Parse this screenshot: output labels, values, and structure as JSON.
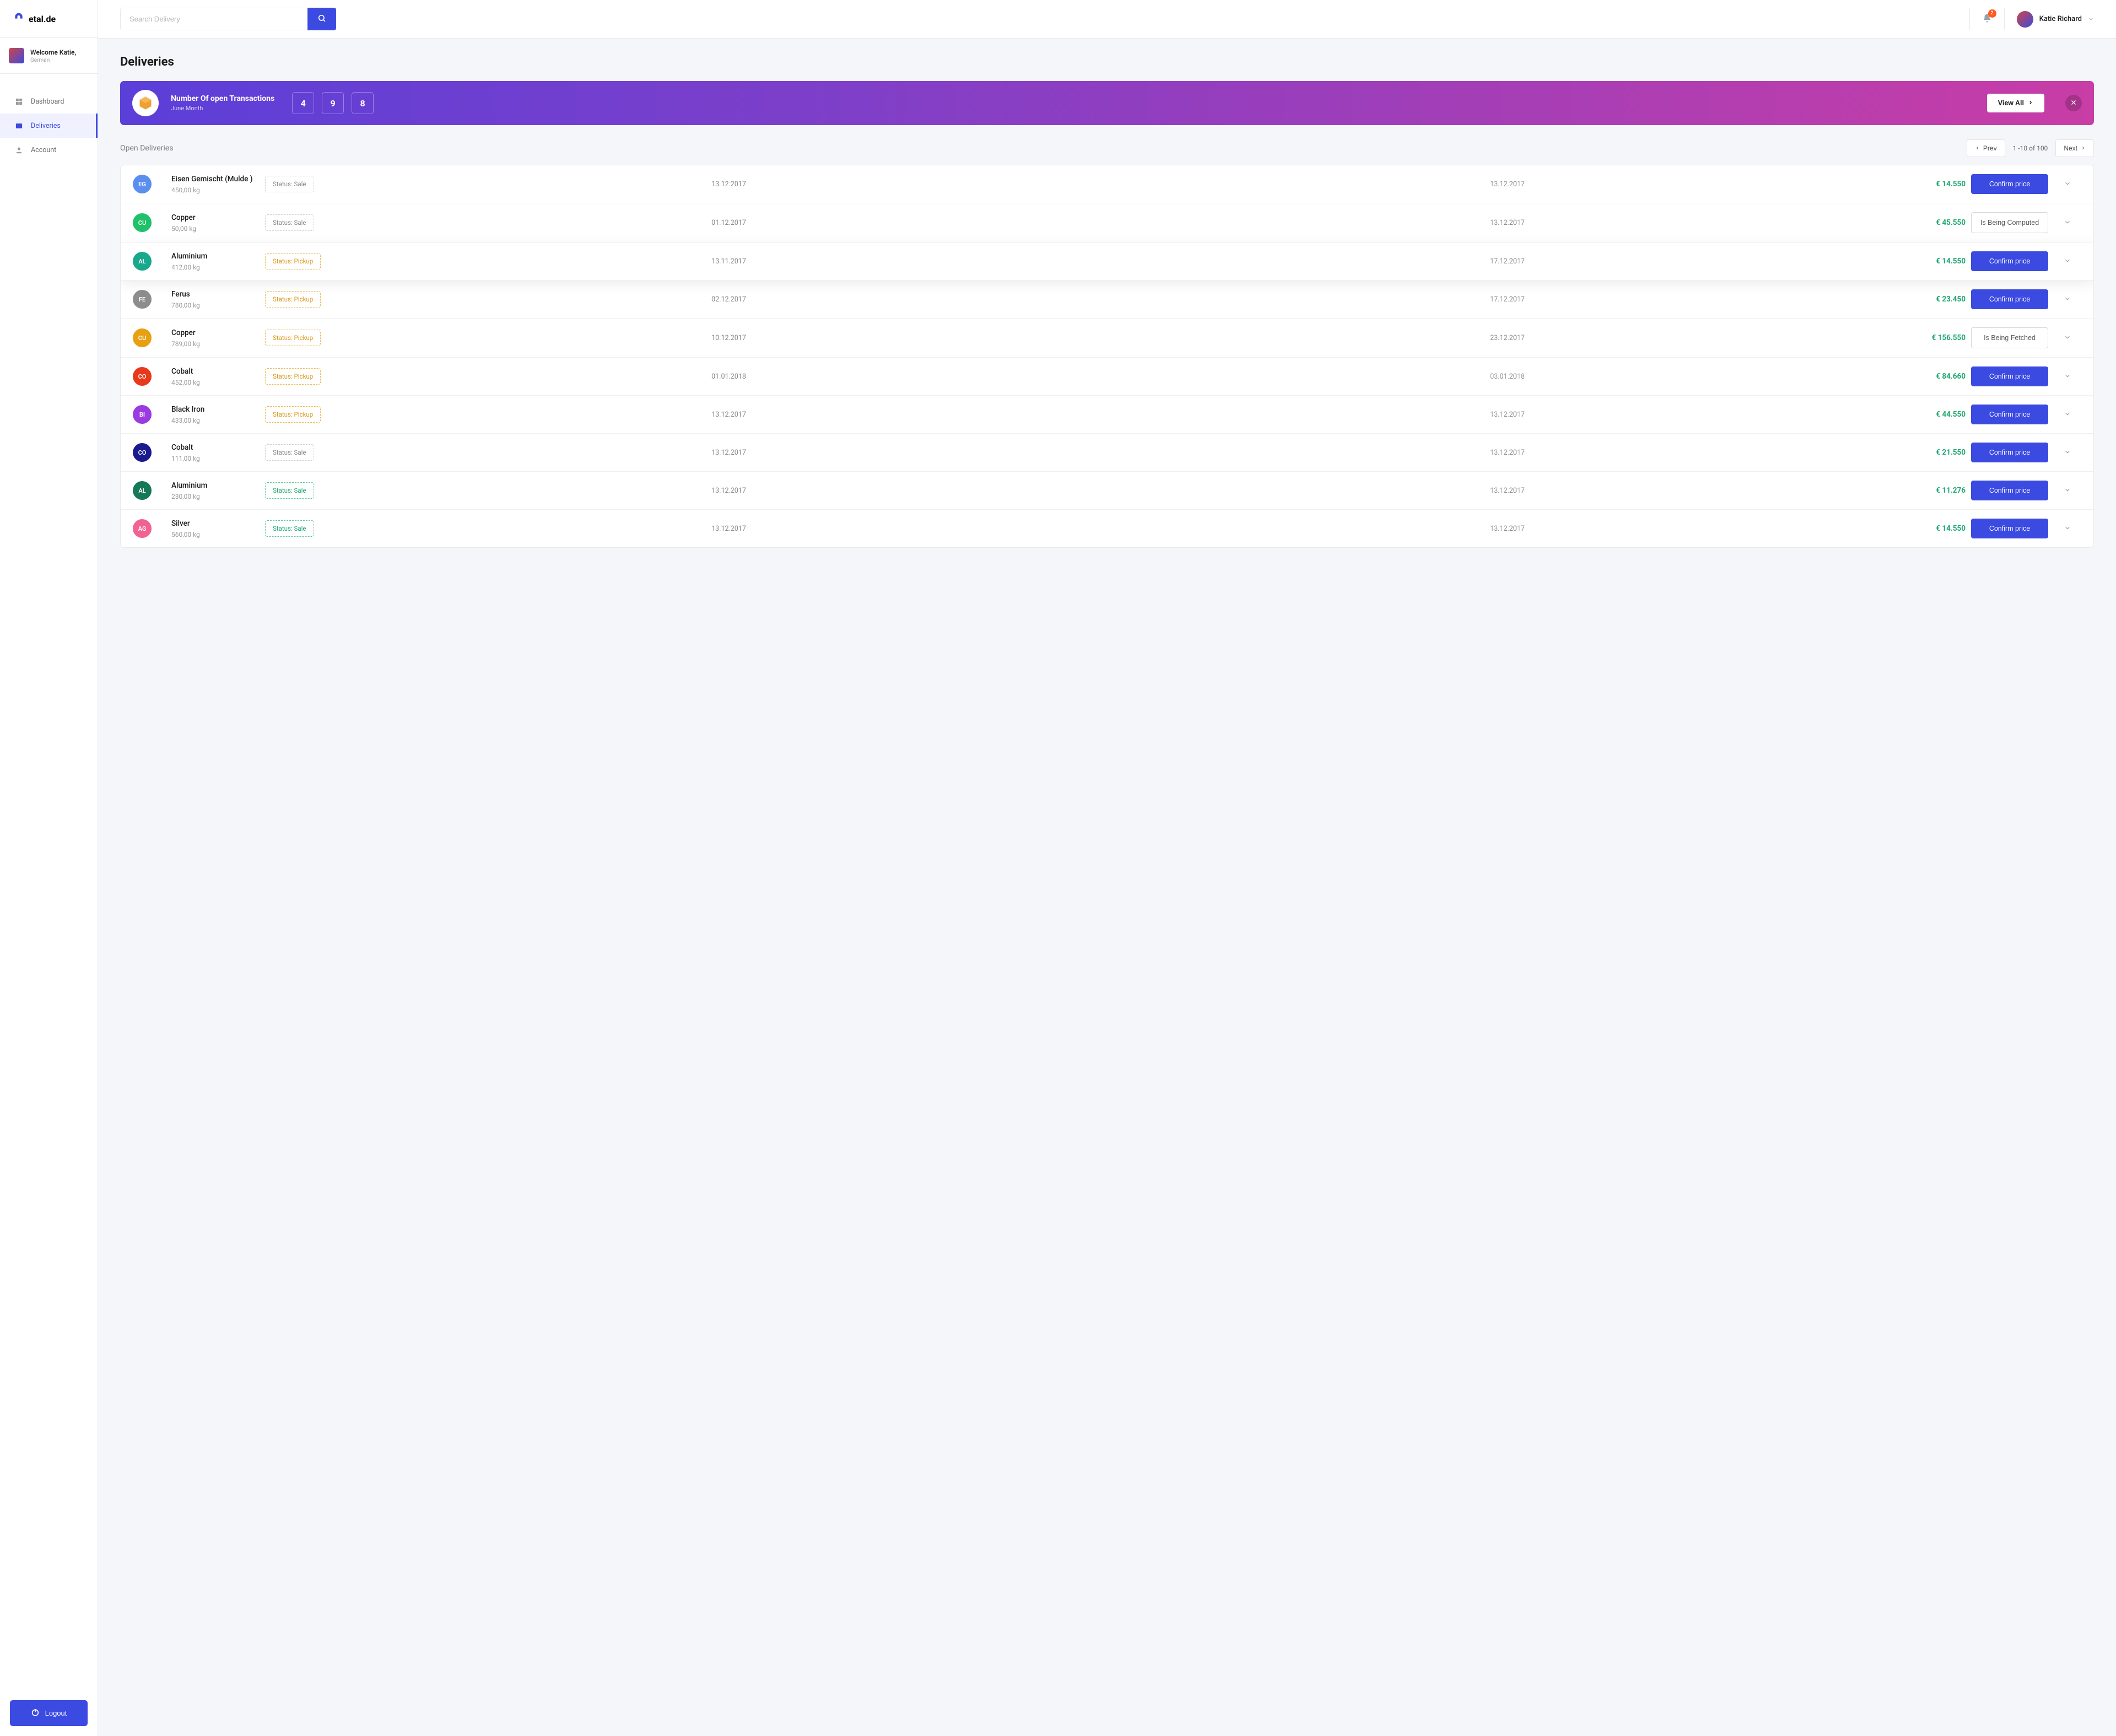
{
  "brand": {
    "name": "etal.de"
  },
  "welcome": {
    "greeting": "Welcome Katie,",
    "lang": "German"
  },
  "nav": {
    "dashboard": "Dashboard",
    "deliveries": "Deliveries",
    "account": "Account"
  },
  "logout_label": "Logout",
  "search": {
    "placeholder": "Search Delivery"
  },
  "notif_count": "2",
  "user": {
    "name": "Katie Richard"
  },
  "page": {
    "title": "Deliveries"
  },
  "banner": {
    "title": "Number Of open Transactions",
    "subtitle": "June Month",
    "nums": [
      "4",
      "9",
      "8"
    ],
    "view_all": "View All"
  },
  "section": {
    "title": "Open Deliveries"
  },
  "pager": {
    "prev": "Prev",
    "next": "Next",
    "info": "1 -10  of  100"
  },
  "actions": {
    "confirm": "Confirm price",
    "computed": "Is Being Computed",
    "fetched": "Is Being Fetched"
  },
  "status_labels": {
    "sale": "Status:  Sale",
    "pickup": "Status:  Pickup"
  },
  "rows": [
    {
      "initials": "EG",
      "color": "#5a8ff0",
      "name": "Eisen Gemischt (Mulde )",
      "weight": "450,00 kg",
      "status": "sale-gray",
      "date1": "13.12.2017",
      "date2": "13.12.2017",
      "price": "€ 14.550",
      "action": "confirm",
      "highlight": false
    },
    {
      "initials": "CU",
      "color": "#1fc16b",
      "name": "Copper",
      "weight": "50,00 kg",
      "status": "sale-gray",
      "date1": "01.12.2017",
      "date2": "13.12.2017",
      "price": "€ 45.550",
      "action": "computed",
      "highlight": false
    },
    {
      "initials": "AL",
      "color": "#1aa88c",
      "name": "Aluminium",
      "weight": "412,00 kg",
      "status": "pickup",
      "date1": "13.11.2017",
      "date2": "17.12.2017",
      "price": "€ 14.550",
      "action": "confirm",
      "highlight": true
    },
    {
      "initials": "FE",
      "color": "#8d8d8d",
      "name": "Ferus",
      "weight": "780,00 kg",
      "status": "pickup",
      "date1": "02.12.2017",
      "date2": "17.12.2017",
      "price": "€ 23.450",
      "action": "confirm",
      "highlight": false
    },
    {
      "initials": "CU",
      "color": "#e8a013",
      "name": "Copper",
      "weight": "789,00 kg",
      "status": "pickup",
      "date1": "10.12.2017",
      "date2": "23.12.2017",
      "price": "€ 156.550",
      "action": "fetched",
      "highlight": false
    },
    {
      "initials": "CO",
      "color": "#e83a1a",
      "name": "Cobalt",
      "weight": "452,00 kg",
      "status": "pickup",
      "date1": "01.01.2018",
      "date2": "03.01.2018",
      "price": "€ 84.660",
      "action": "confirm",
      "highlight": false
    },
    {
      "initials": "BI",
      "color": "#9a3ae0",
      "name": "Black Iron",
      "weight": "433,00 kg",
      "status": "pickup",
      "date1": "13.12.2017",
      "date2": "13.12.2017",
      "price": "€ 44.550",
      "action": "confirm",
      "highlight": false
    },
    {
      "initials": "CO",
      "color": "#1a1a8f",
      "name": "Cobalt",
      "weight": "111,00 kg",
      "status": "sale-gray",
      "date1": "13.12.2017",
      "date2": "13.12.2017",
      "price": "€ 21.550",
      "action": "confirm",
      "highlight": false
    },
    {
      "initials": "AL",
      "color": "#157857",
      "name": "Aluminium",
      "weight": "230,00 kg",
      "status": "sale-green",
      "date1": "13.12.2017",
      "date2": "13.12.2017",
      "price": "€ 11.276",
      "action": "confirm",
      "highlight": false
    },
    {
      "initials": "AG",
      "color": "#f06292",
      "name": "Silver",
      "weight": "560,00 kg",
      "status": "sale-green",
      "date1": "13.12.2017",
      "date2": "13.12.2017",
      "price": "€ 14.550",
      "action": "confirm",
      "highlight": false
    }
  ]
}
